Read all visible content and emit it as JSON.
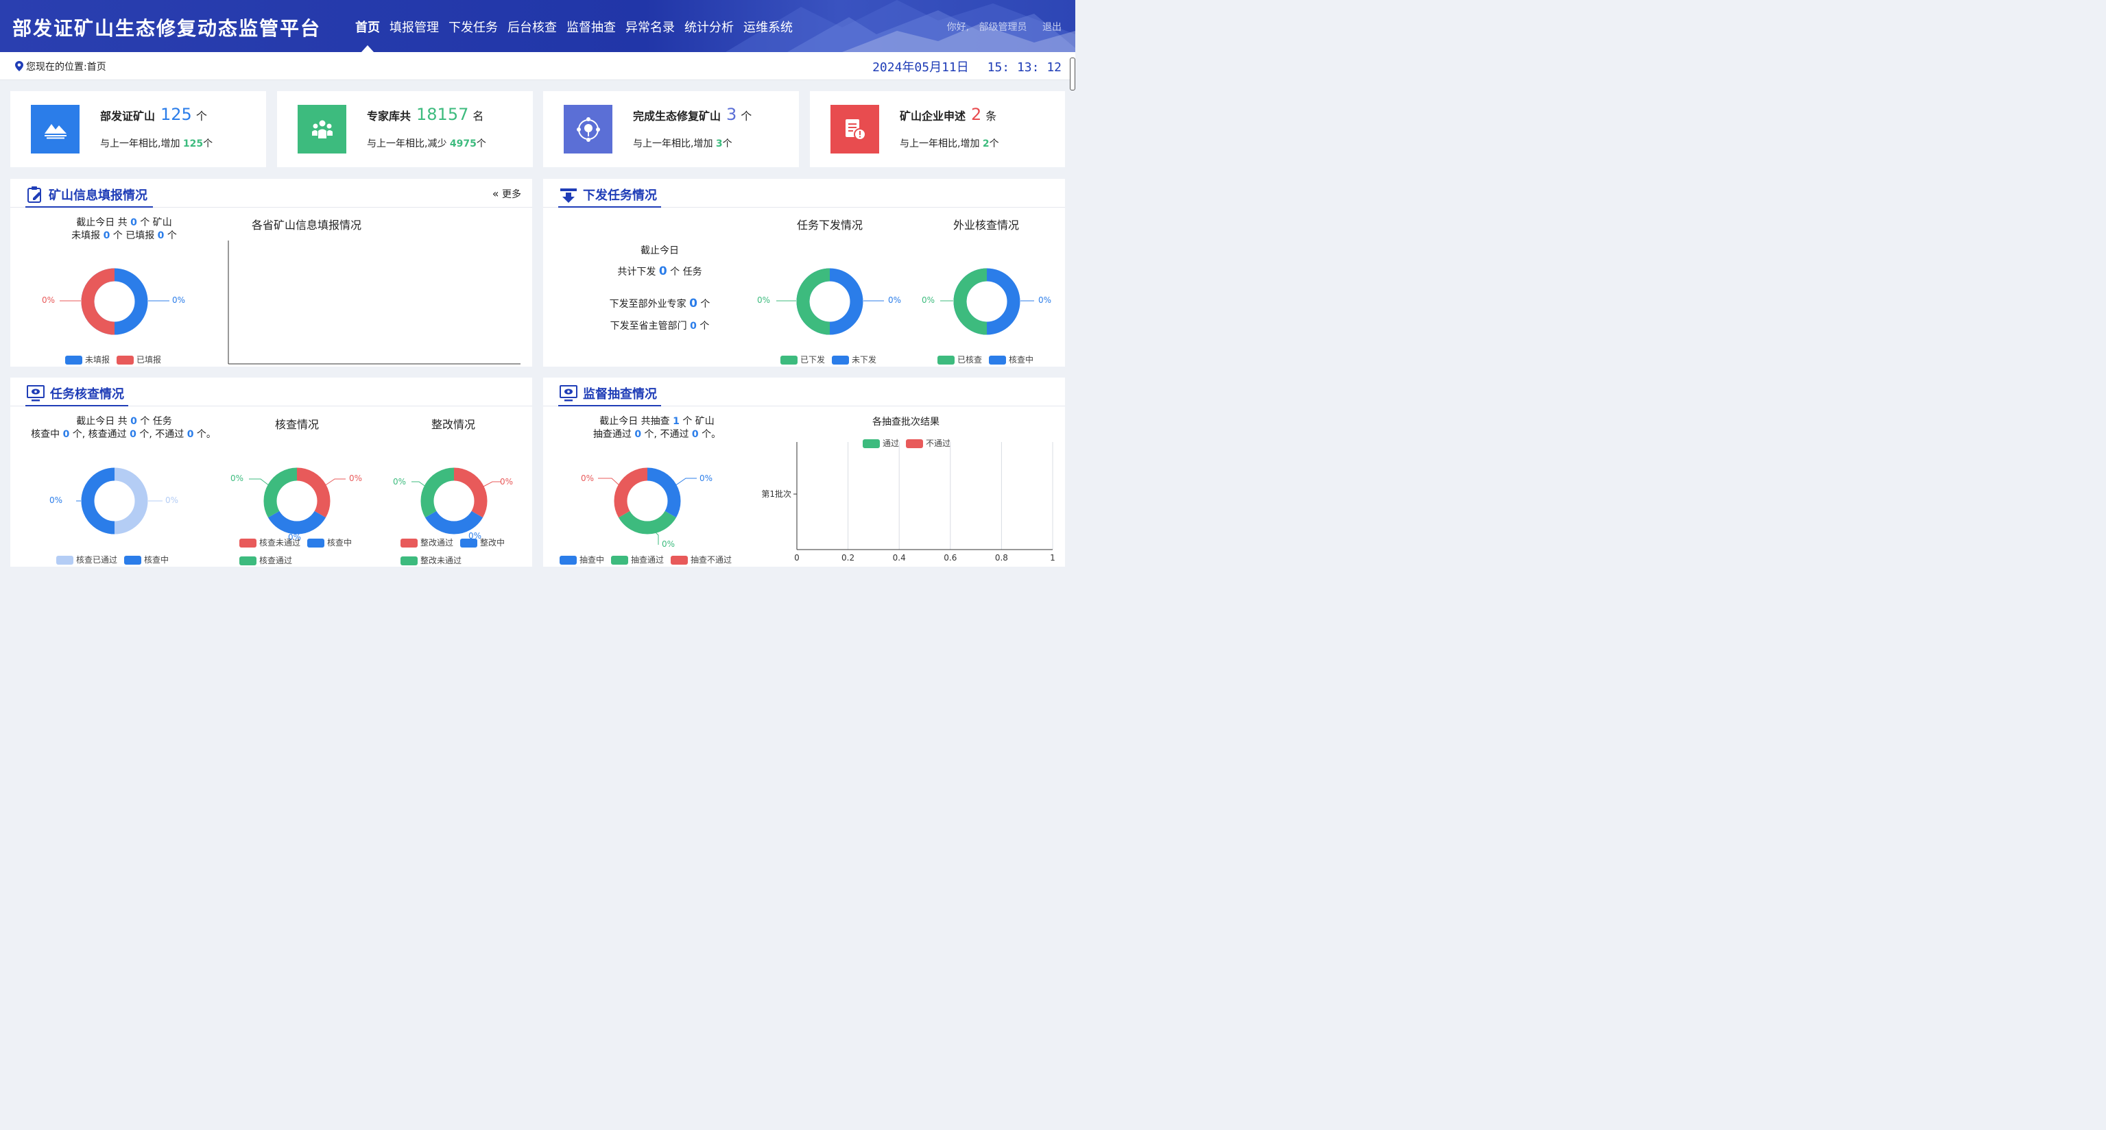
{
  "header": {
    "title": "部发证矿山生态修复动态监管平台",
    "nav": [
      "首页",
      "填报管理",
      "下发任务",
      "后台核查",
      "监督抽查",
      "异常名录",
      "统计分析",
      "运维系统"
    ],
    "greeting": "你好,",
    "user": "部级管理员",
    "logout": "退出"
  },
  "breadcrumb": {
    "label": "您现在的位置:",
    "current": "首页"
  },
  "clock": {
    "date": "2024年05月11日",
    "time": "15: 13: 12"
  },
  "stats": [
    {
      "label": "部发证矿山",
      "value": "125",
      "unit": "个",
      "compare": "与上一年相比,增加",
      "delta": "125",
      "delta_unit": "个",
      "color": "#2b7de9",
      "icon": "mountain-icon"
    },
    {
      "label": "专家库共",
      "value": "18157",
      "unit": "名",
      "compare": "与上一年相比,减少",
      "delta": "4975",
      "delta_unit": "个",
      "color": "#3dbb7e",
      "icon": "experts-icon"
    },
    {
      "label": "完成生态修复矿山",
      "value": "3",
      "unit": "个",
      "compare": "与上一年相比,增加",
      "delta": "3",
      "delta_unit": "个",
      "color": "#5b6fd6",
      "icon": "ecology-icon"
    },
    {
      "label": "矿山企业申述",
      "value": "2",
      "unit": "条",
      "compare": "与上一年相比,增加",
      "delta": "2",
      "delta_unit": "个",
      "color": "#e84c4f",
      "icon": "complaint-icon"
    }
  ],
  "fill_panel": {
    "title": "矿山信息填报情况",
    "more": "更多",
    "summary1_pre": "截止今日 共",
    "summary1_num": "0",
    "summary1_post": "个 矿山",
    "summary2_a": "未填报",
    "summary2_n1": "0",
    "summary2_b": "个 已填报",
    "summary2_n2": "0",
    "summary2_c": "个",
    "donut_left": "0%",
    "donut_right": "0%",
    "legend": [
      "未填报",
      "已填报"
    ],
    "bar_title": "各省矿山信息填报情况"
  },
  "task_panel": {
    "title": "下发任务情况",
    "line1": "截止今日",
    "line2_pre": "共计下发",
    "line2_num": "0",
    "line2_post": "个  任务",
    "line3_pre": "下发至部外业专家",
    "line3_num": "0",
    "line3_post": "个",
    "line4_pre": "下发至省主管部门",
    "line4_num": "0",
    "line4_post": "个",
    "chart1_title": "任务下发情况",
    "chart1_left": "0%",
    "chart1_right": "0%",
    "chart1_legend": [
      "已下发",
      "未下发"
    ],
    "chart2_title": "外业核查情况",
    "chart2_left": "0%",
    "chart2_right": "0%",
    "chart2_legend": [
      "已核查",
      "核查中"
    ]
  },
  "check_panel": {
    "title": "任务核查情况",
    "s1_pre": "截止今日 共",
    "s1_num": "0",
    "s1_post": "个 任务",
    "s2_a": "核查中",
    "s2_n1": "0",
    "s2_b": "个, 核查通过",
    "s2_n2": "0",
    "s2_c": "个, 不通过",
    "s2_n3": "0",
    "s2_d": "个。",
    "donut1_left": "0%",
    "donut1_right": "0%",
    "donut1_legend": [
      "核查已通过",
      "核查中"
    ],
    "chart2_title": "核查情况",
    "chart2_left": "0%",
    "chart2_right": "0%",
    "chart2_bottom": "0%",
    "chart2_legend": [
      "核查未通过",
      "核查中",
      "核查通过"
    ],
    "chart3_title": "整改情况",
    "chart3_left": "0%",
    "chart3_right": "0%",
    "chart3_bottom": "0%",
    "chart3_legend": [
      "整改通过",
      "整改中",
      "整改未通过"
    ]
  },
  "super_panel": {
    "title": "监督抽查情况",
    "s1_pre": "截止今日 共抽查",
    "s1_num": "1",
    "s1_post": "个 矿山",
    "s2_a": "抽查通过",
    "s2_n1": "0",
    "s2_b": "个, 不通过",
    "s2_n2": "0",
    "s2_c": "个。",
    "donut_left": "0%",
    "donut_right": "0%",
    "donut_bottom": "0%",
    "donut_legend": [
      "抽查中",
      "抽查通过",
      "抽查不通过"
    ],
    "bar_title": "各抽查批次结果",
    "bar_legend": [
      "通过",
      "不通过"
    ],
    "bar_category": "第1批次",
    "xticks": [
      "0",
      "0.2",
      "0.4",
      "0.6",
      "0.8",
      "1"
    ]
  },
  "colors": {
    "blue": "#2b7de9",
    "green": "#3dbb7e",
    "red": "#e85a5a",
    "lightblue": "#b4cdf5",
    "navy": "#1f3db7"
  }
}
